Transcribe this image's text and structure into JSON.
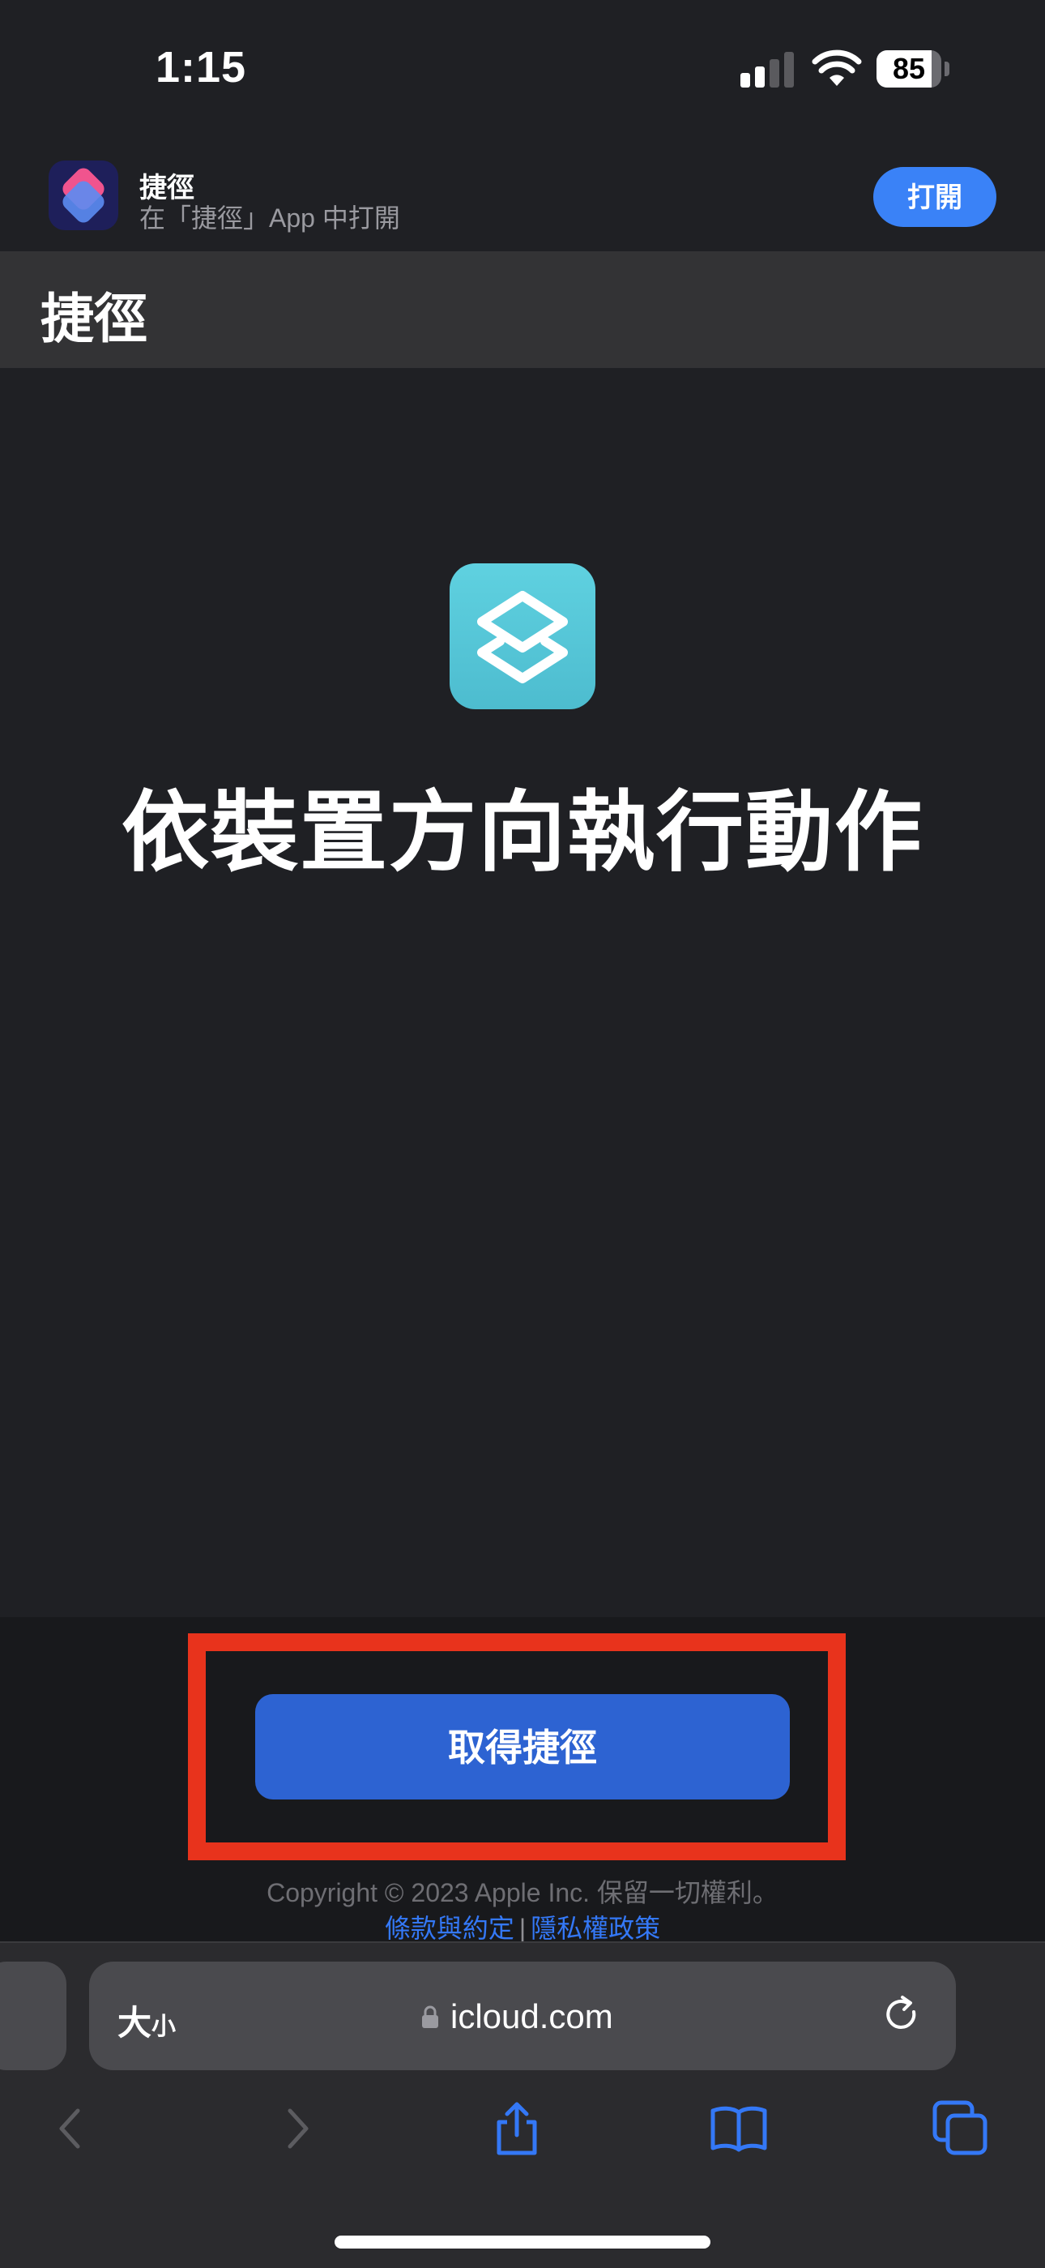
{
  "status_bar": {
    "time": "1:15",
    "battery_level": "85",
    "battery_fraction": 0.85
  },
  "banner": {
    "app_name": "捷徑",
    "subtitle": "在「捷徑」App 中打開",
    "open_label": "打開",
    "icon": "shortcuts-app-icon"
  },
  "page": {
    "title": "捷徑"
  },
  "shortcut": {
    "icon": "layers-icon",
    "name": "依裝置方向執行動作",
    "accent_color": "#5fd1e0"
  },
  "footer": {
    "get_button_label": "取得捷徑",
    "copyright": "Copyright © 2023 Apple Inc. 保留一切權利。",
    "links": [
      "條款與約定",
      "隱私權政策"
    ],
    "link_separator": "|",
    "highlight_color": "#e8331c"
  },
  "safari": {
    "text_size_label": "大",
    "text_size_small": "小",
    "url": "icloud.com",
    "toolbar": [
      "back-icon",
      "forward-icon",
      "share-icon",
      "bookmarks-icon",
      "tabs-icon"
    ]
  }
}
